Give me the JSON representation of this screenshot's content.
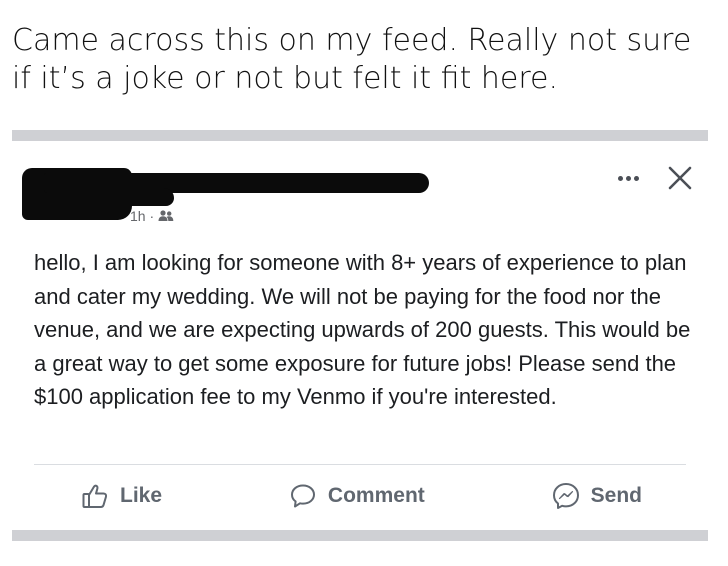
{
  "caption": {
    "text": "Came across this on my feed. Really not sure if it’s a joke or not but felt it fit here."
  },
  "post": {
    "timestamp": "1h ·",
    "audience_icon": "friends-icon",
    "body": "hello, I am looking for someone with 8+ years of experience to plan and cater my wedding. We will not be paying for the food nor the venue, and we are expecting upwards of 200 guests. This would be a great way to get some exposure for future jobs! Please send the $100 application fee to my Venmo if you're interested."
  },
  "header_actions": {
    "more_icon": "more-icon",
    "close_icon": "close-icon"
  },
  "actions": [
    {
      "label": "Like",
      "icon": "thumbs-up-icon"
    },
    {
      "label": "Comment",
      "icon": "comment-icon"
    },
    {
      "label": "Send",
      "icon": "messenger-icon"
    }
  ],
  "colors": {
    "separator": "#cfd0d4",
    "action_text": "#606770",
    "body_text": "#1c1e21"
  }
}
